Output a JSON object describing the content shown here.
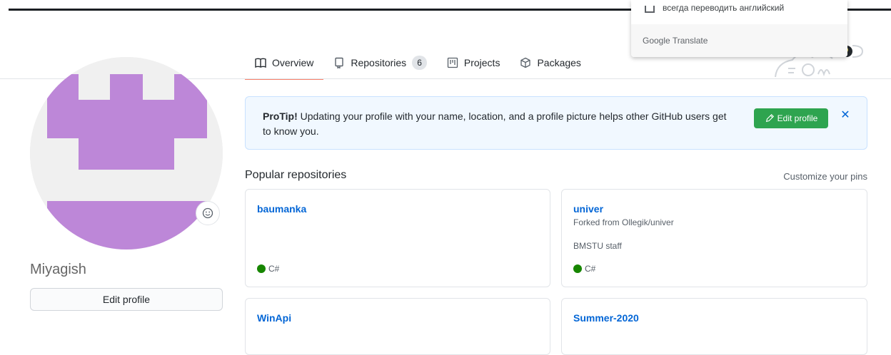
{
  "tabs": [
    {
      "label": "Overview",
      "icon": "book-icon"
    },
    {
      "label": "Repositories",
      "icon": "repo-icon",
      "count": "6"
    },
    {
      "label": "Projects",
      "icon": "project-icon"
    },
    {
      "label": "Packages",
      "icon": "package-icon"
    }
  ],
  "profile": {
    "username": "Miyagish",
    "edit_button": "Edit profile",
    "avatar_color": "#bd87d8"
  },
  "protip": {
    "bold": "ProTip!",
    "text": " Updating your profile with your name, location, and a profile picture helps other GitHub users get to know you.",
    "button": "Edit profile",
    "close": "✕"
  },
  "popular": {
    "title": "Popular repositories",
    "customize": "Customize your pins",
    "repos": [
      {
        "name": "baumanka",
        "language": "C#"
      },
      {
        "name": "univer",
        "forked": "Forked from Ollegik/univer",
        "description": "BMSTU staff",
        "language": "C#"
      },
      {
        "name": "WinApi"
      },
      {
        "name": "Summer-2020"
      }
    ]
  },
  "translate": {
    "option": "всегда переводить английский",
    "brand": "Google Translate"
  },
  "colors": {
    "accent": "#f9826c",
    "link": "#0366d6",
    "green": "#2ea44f",
    "csharp": "#178600"
  }
}
